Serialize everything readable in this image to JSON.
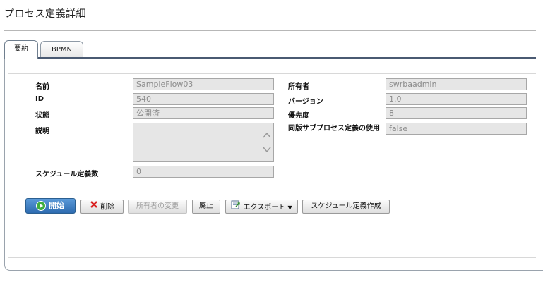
{
  "page": {
    "title": "プロセス定義詳細"
  },
  "tabs": [
    {
      "label": "要約",
      "active": true
    },
    {
      "label": "BPMN",
      "active": false
    }
  ],
  "fields": {
    "name": {
      "label": "名前",
      "value": "SampleFlow03"
    },
    "id": {
      "label": "ID",
      "value": "540"
    },
    "status": {
      "label": "状態",
      "value": "公開済"
    },
    "description": {
      "label": "説明",
      "value": ""
    },
    "schedule_count": {
      "label": "スケジュール定義数",
      "value": "0"
    },
    "owner": {
      "label": "所有者",
      "value": "swrbaadmin"
    },
    "version": {
      "label": "バージョン",
      "value": "1.0"
    },
    "priority": {
      "label": "優先度",
      "value": "8"
    },
    "same_version_subprocess": {
      "label": "同版サブプロセス定義の使用",
      "value": "false"
    }
  },
  "buttons": {
    "start": {
      "label": "開始",
      "icon": "play-icon",
      "enabled": true
    },
    "delete": {
      "label": "削除",
      "icon": "red-x-icon",
      "enabled": true
    },
    "change_owner": {
      "label": "所有者の変更",
      "enabled": false
    },
    "abolish": {
      "label": "廃止",
      "enabled": true
    },
    "export": {
      "label": "エクスポート",
      "icon": "export-icon",
      "enabled": true
    },
    "create_schedule": {
      "label": "スケジュール定義作成",
      "enabled": true
    }
  },
  "colors": {
    "primary_button": "#2d6bb0",
    "tab_strip": "#4a5a72",
    "field_bg": "#e6e6e6",
    "delete_icon": "#d92020"
  }
}
